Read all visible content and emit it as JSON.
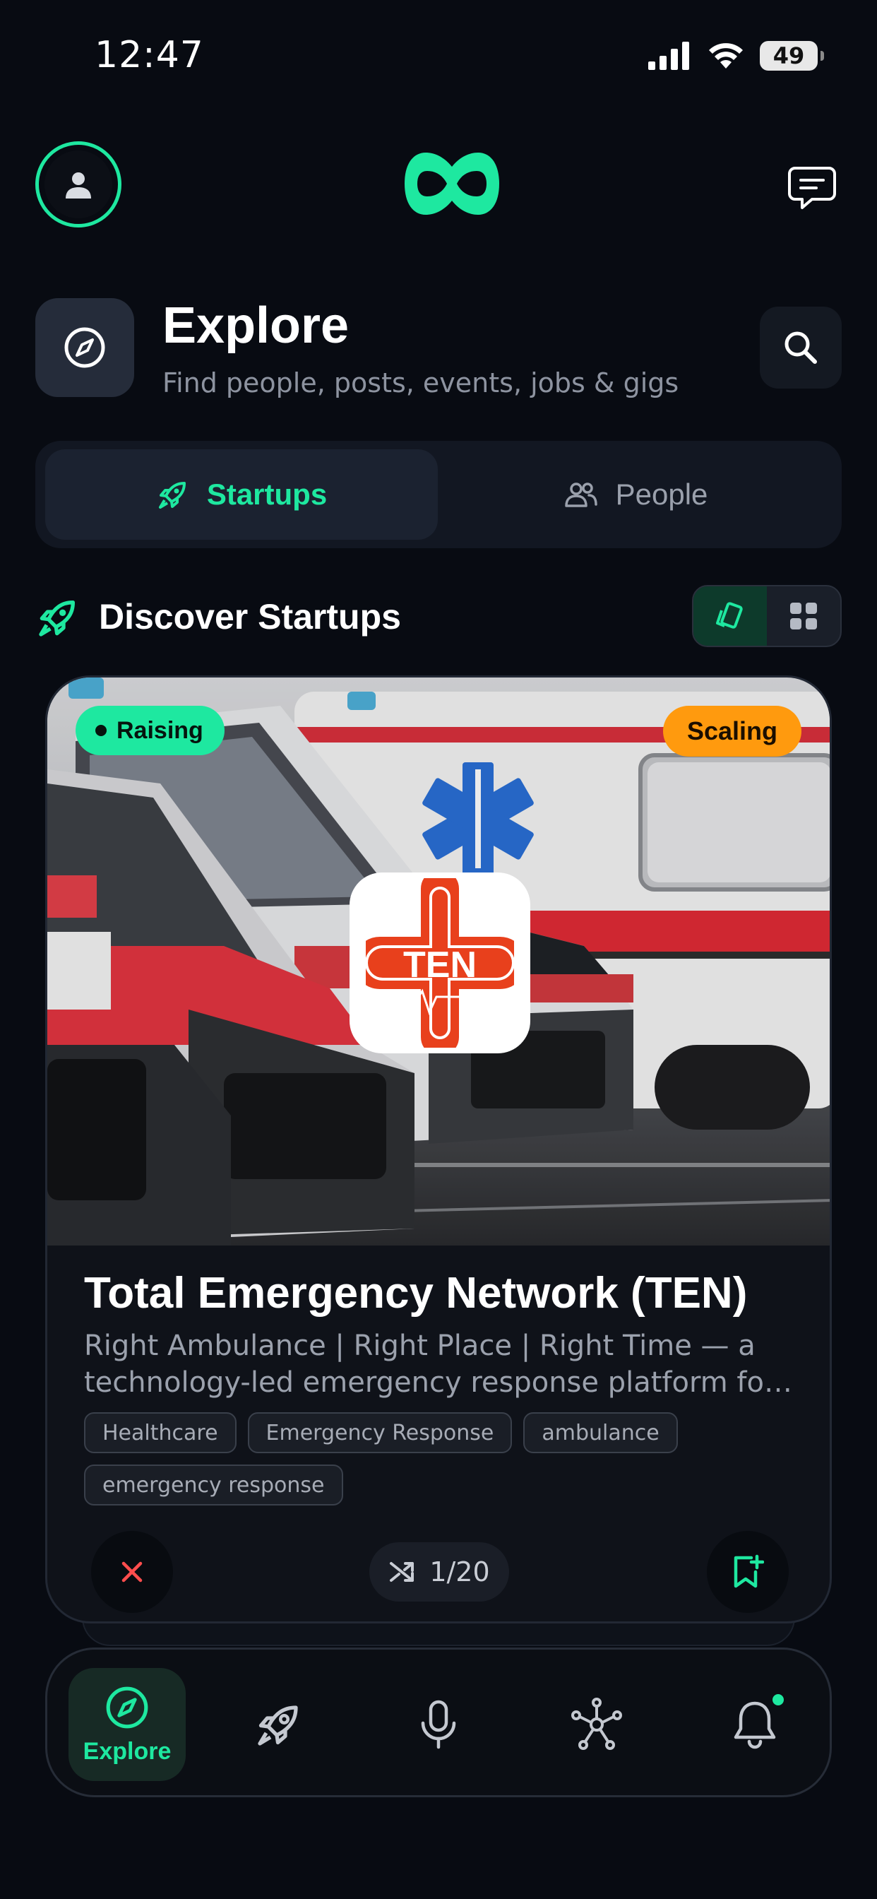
{
  "status_bar": {
    "time": "12:47",
    "battery": "49"
  },
  "header": {
    "title": "Explore",
    "subtitle": "Find people, posts, events, jobs & gigs"
  },
  "tabs": [
    {
      "label": "Startups",
      "active": true
    },
    {
      "label": "People",
      "active": false
    }
  ],
  "section": {
    "title": "Discover Startups"
  },
  "card": {
    "badge_left": "Raising",
    "badge_right": "Scaling",
    "logo_text": "TEN",
    "title": "Total Emergency Network (TEN)",
    "description": "Right Ambulance | Right Place | Right Time — a technology-led emergency response platform for India",
    "tags": [
      "Healthcare",
      "Emergency Response",
      "ambulance",
      "emergency response"
    ],
    "counter": "1/20"
  },
  "nav": {
    "items": [
      {
        "label": "Explore",
        "icon": "compass-icon",
        "active": true
      },
      {
        "label": "",
        "icon": "rocket-icon",
        "active": false
      },
      {
        "label": "",
        "icon": "microphone-icon",
        "active": false
      },
      {
        "label": "",
        "icon": "network-icon",
        "active": false
      },
      {
        "label": "",
        "icon": "bell-icon",
        "active": false
      }
    ]
  },
  "colors": {
    "accent": "#1ee8a0",
    "background": "#080b12",
    "scaling": "#ff9a0e",
    "close": "#ff4d4d"
  }
}
